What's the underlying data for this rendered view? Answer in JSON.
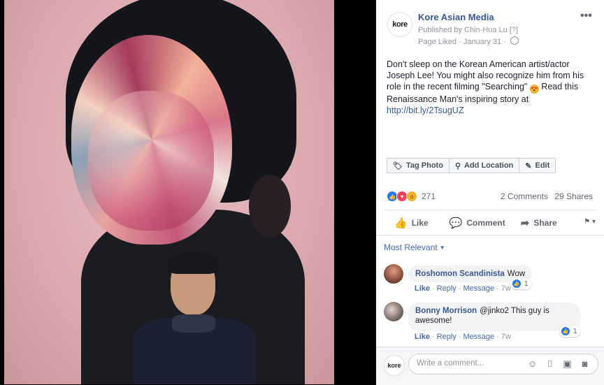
{
  "post": {
    "page_name": "Kore Asian Media",
    "avatar_text": "kore",
    "published_by": "Published by Chin-Hua Lu",
    "published_help": "[?]",
    "page_liked": "Page Liked",
    "date": "January 31",
    "text_part1": "Don't sleep on the Korean American artist/actor Joseph Lee! You might also recognize him from his role in the recent filming \"Searching\"",
    "emoji": "😍",
    "text_part2": " Read this Renaissance Man's inspiring story at ",
    "link": "http://bit.ly/2TsugUZ"
  },
  "photo_tools": {
    "tag_photo": "Tag Photo",
    "add_location": "Add Location",
    "edit": "Edit"
  },
  "reactions": {
    "count": "271",
    "comments": "2 Comments",
    "shares": "29 Shares"
  },
  "actions": {
    "like": "Like",
    "comment": "Comment",
    "share": "Share"
  },
  "comments_filter": "Most Relevant",
  "comments": [
    {
      "author": "Roshomon Scandinista",
      "text": "Wow",
      "like": "Like",
      "reply": "Reply",
      "message": "Message",
      "time": "7w",
      "reactions": "1"
    },
    {
      "author": "Bonny Morrison",
      "text": "@jinko2 This guy is awesome!",
      "like": "Like",
      "reply": "Reply",
      "message": "Message",
      "time": "7w",
      "reactions": "1"
    }
  ],
  "composer": {
    "placeholder": "Write a comment...",
    "avatar_text": "kore"
  },
  "colors": {
    "link": "#365899",
    "like_blue": "#2078f4",
    "love_red": "#f33e58",
    "wow_yellow": "#f7b125"
  }
}
